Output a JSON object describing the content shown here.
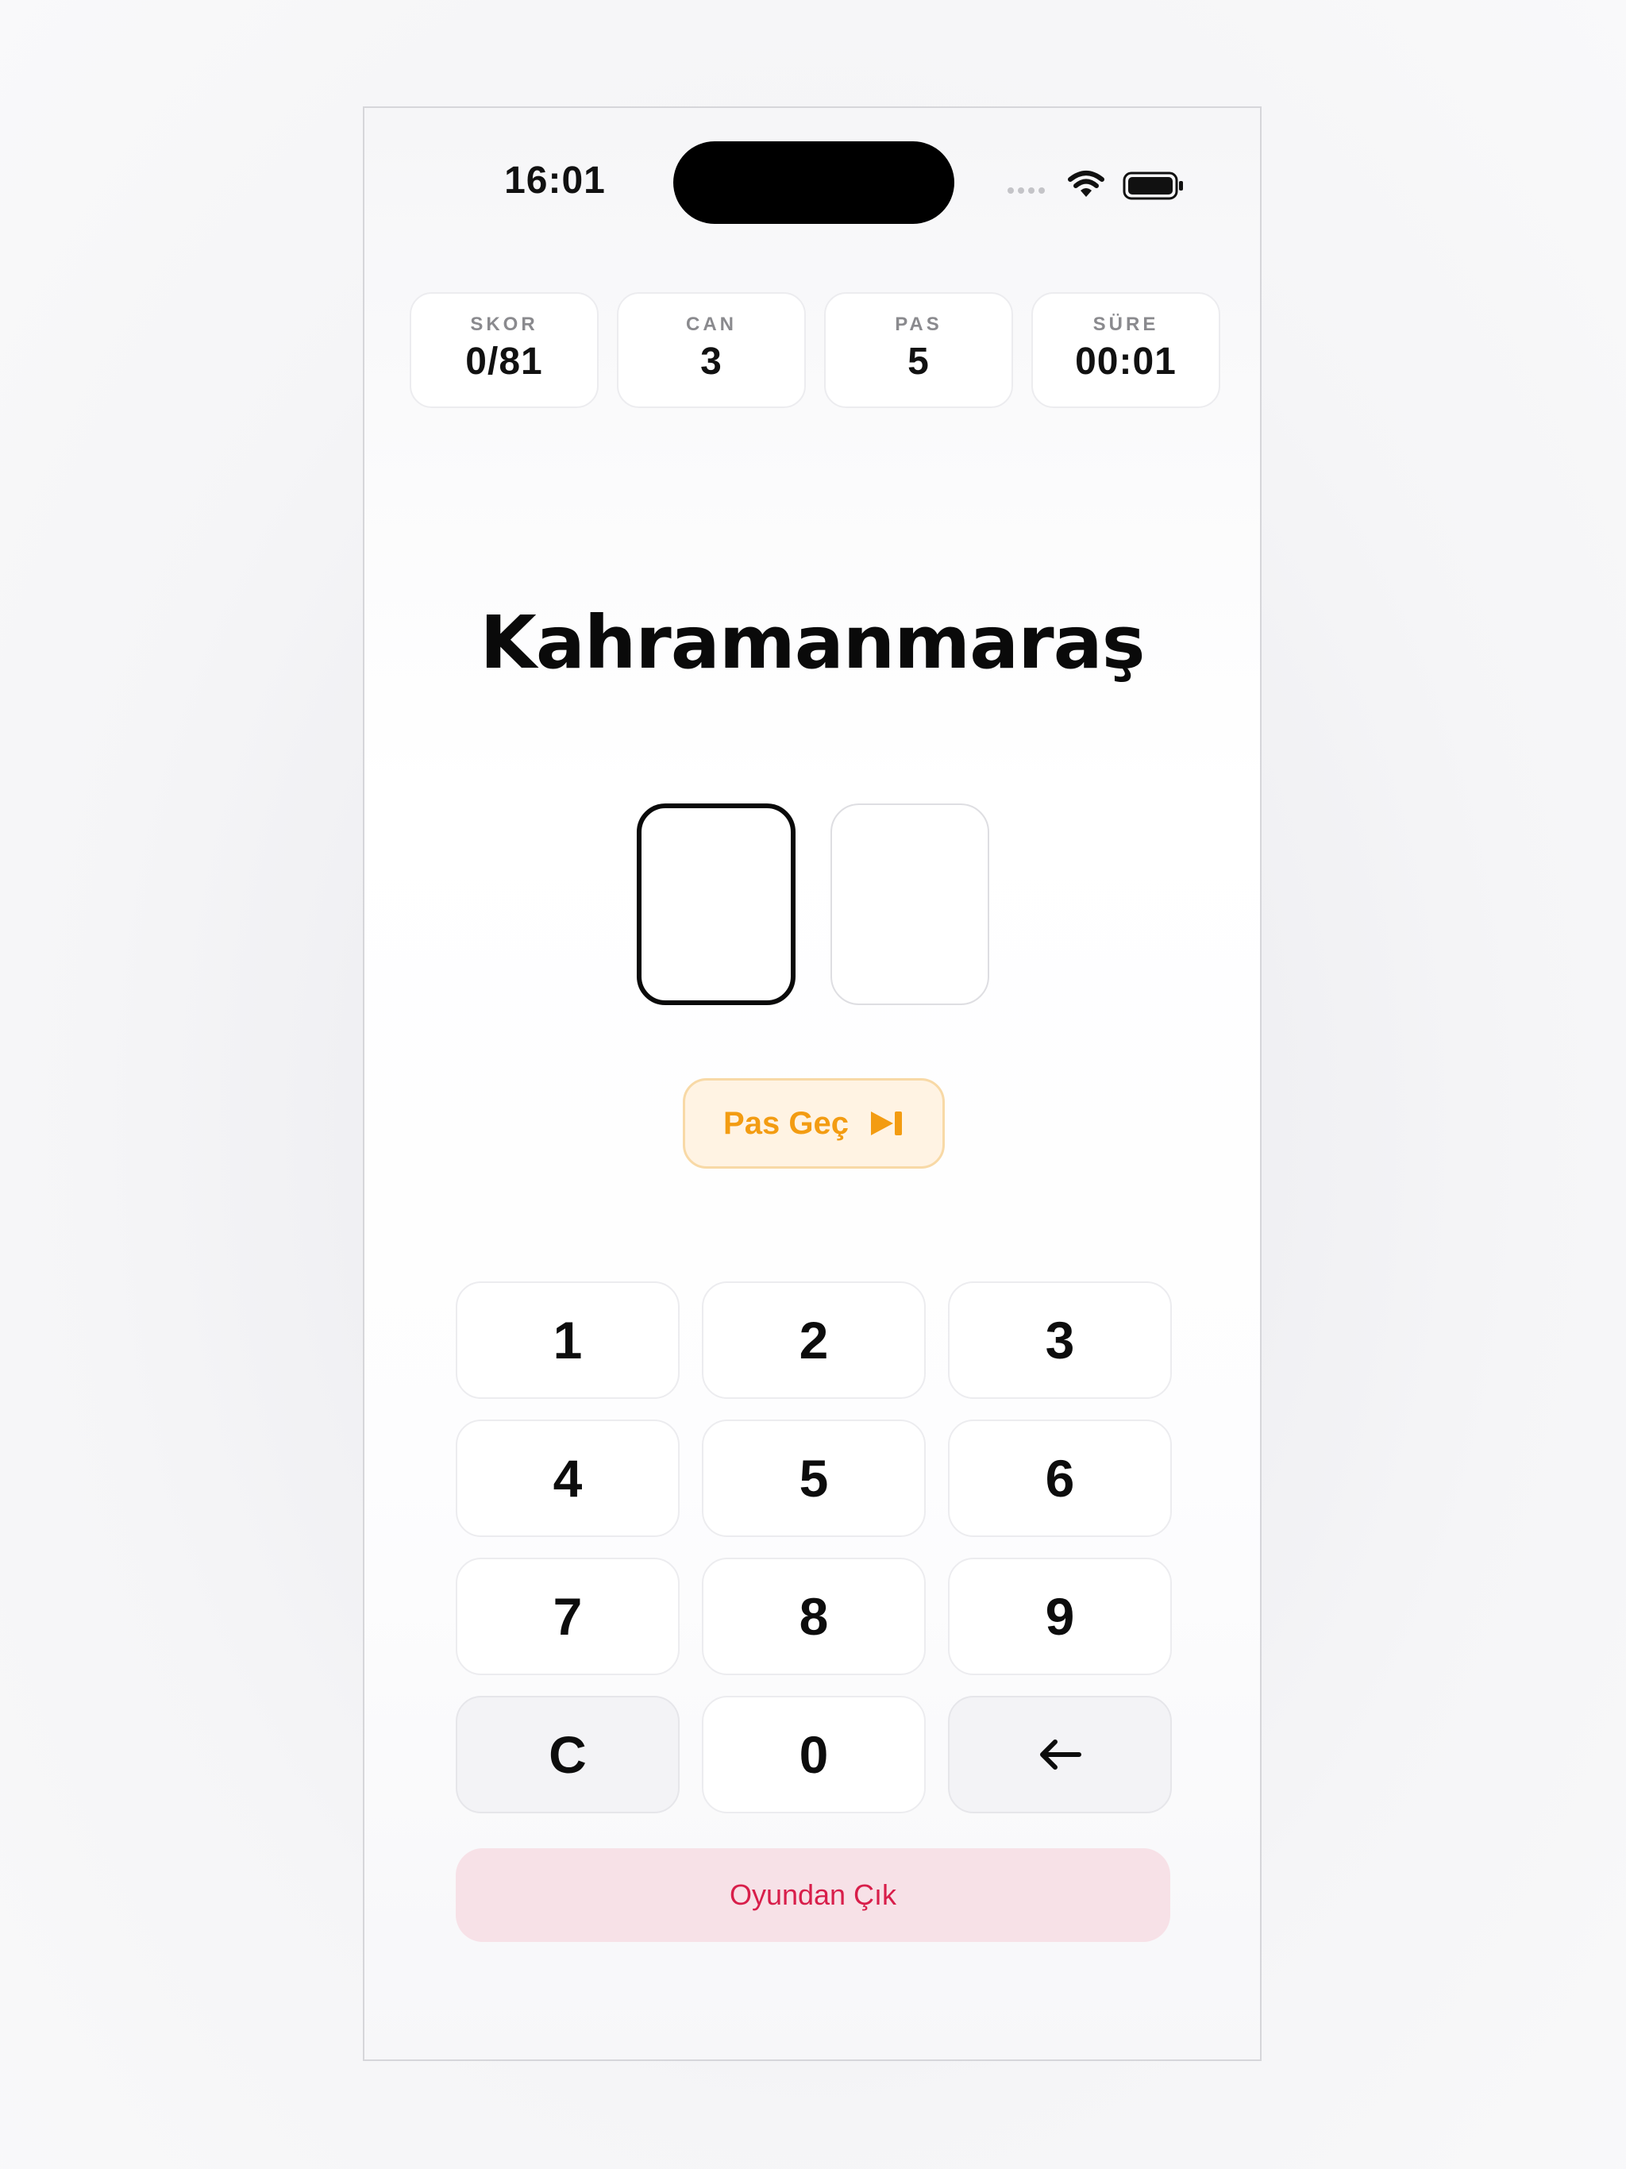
{
  "status_bar": {
    "time": "16:01",
    "icons": [
      "signal-dots-icon",
      "wifi-icon",
      "battery-icon"
    ]
  },
  "stats": [
    {
      "label": "SKOR",
      "value": "0/81"
    },
    {
      "label": "CAN",
      "value": "3"
    },
    {
      "label": "PAS",
      "value": "5"
    },
    {
      "label": "SÜRE",
      "value": "00:01"
    }
  ],
  "question": {
    "city": "Kahramanmaraş"
  },
  "answer": {
    "digits": [
      "",
      ""
    ],
    "active_index": 0
  },
  "skip": {
    "label": "Pas Geç",
    "icon": "skip-forward-icon",
    "color": "#f39c12"
  },
  "keypad": {
    "keys": [
      "1",
      "2",
      "3",
      "4",
      "5",
      "6",
      "7",
      "8",
      "9",
      "C",
      "0"
    ],
    "backspace_icon": "arrow-left-icon"
  },
  "exit": {
    "label": "Oyundan Çık",
    "color": "#d81e4a"
  }
}
